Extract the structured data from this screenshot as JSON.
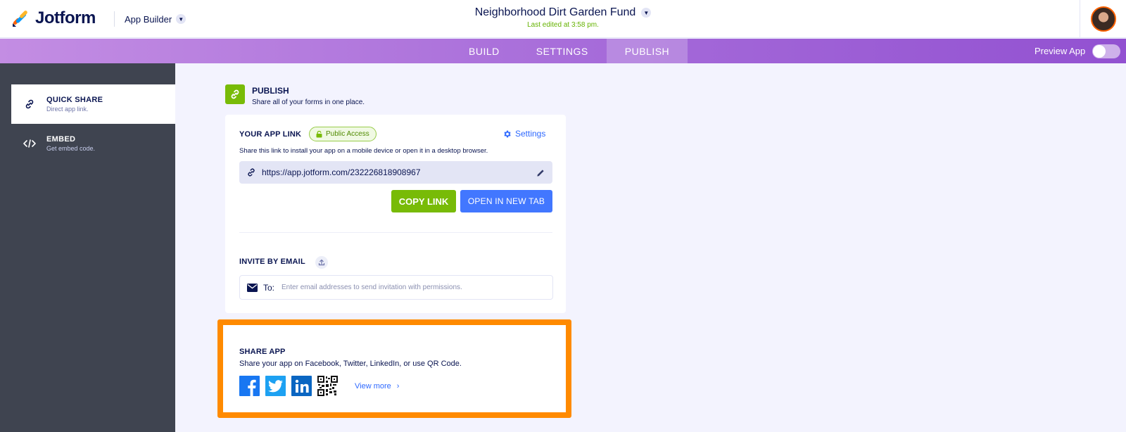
{
  "header": {
    "logo_text": "Jotform",
    "app_builder_label": "App Builder",
    "form_title": "Neighborhood Dirt Garden Fund",
    "last_edited": "Last edited at 3:58 pm."
  },
  "nav": {
    "tabs": [
      {
        "label": "BUILD",
        "active": false
      },
      {
        "label": "SETTINGS",
        "active": false
      },
      {
        "label": "PUBLISH",
        "active": true
      }
    ],
    "preview_label": "Preview App"
  },
  "sidebar": {
    "items": [
      {
        "title": "QUICK SHARE",
        "subtitle": "Direct app link.",
        "icon": "link-icon",
        "active": true
      },
      {
        "title": "EMBED",
        "subtitle": "Get embed code.",
        "icon": "code-icon",
        "active": false
      }
    ]
  },
  "publish": {
    "title": "PUBLISH",
    "subtitle": "Share all of your forms in one place."
  },
  "app_link": {
    "label": "YOUR APP LINK",
    "badge": "Public Access",
    "settings_label": "Settings",
    "description": "Share this link to install your app on a mobile device or open it in a desktop browser.",
    "url": "https://app.jotform.com/232226818908967",
    "copy_label": "COPY LINK",
    "open_label": "OPEN IN NEW TAB"
  },
  "invite": {
    "label": "INVITE BY EMAIL",
    "to_label": "To:",
    "placeholder": "Enter email addresses to send invitation with permissions."
  },
  "share": {
    "title": "SHARE APP",
    "description": "Share your app on Facebook, Twitter, LinkedIn, or use QR Code.",
    "view_more": "View more"
  },
  "colors": {
    "highlight_border": "#ff8a00",
    "green": "#78bb07",
    "blue": "#4277ff",
    "navy": "#0a1551",
    "purple": "#a56ad9"
  }
}
